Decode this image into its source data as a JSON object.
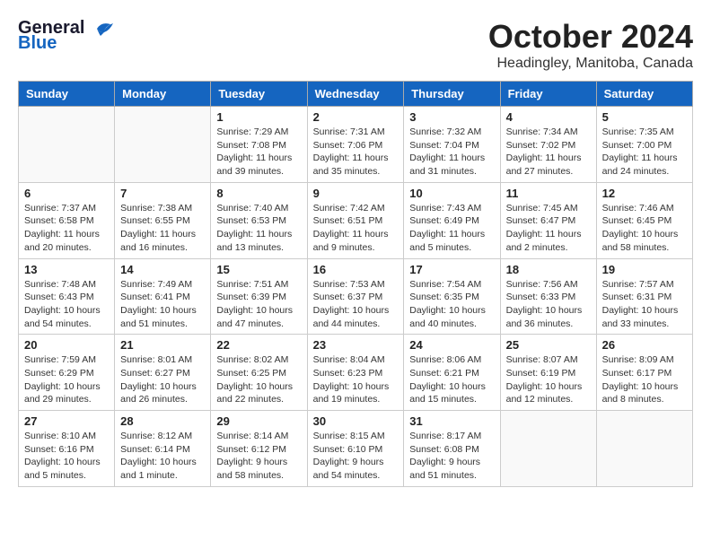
{
  "header": {
    "logo_general": "General",
    "logo_blue": "Blue",
    "month": "October 2024",
    "location": "Headingley, Manitoba, Canada"
  },
  "weekdays": [
    "Sunday",
    "Monday",
    "Tuesday",
    "Wednesday",
    "Thursday",
    "Friday",
    "Saturday"
  ],
  "weeks": [
    [
      {
        "day": "",
        "info": ""
      },
      {
        "day": "",
        "info": ""
      },
      {
        "day": "1",
        "info": "Sunrise: 7:29 AM\nSunset: 7:08 PM\nDaylight: 11 hours and 39 minutes."
      },
      {
        "day": "2",
        "info": "Sunrise: 7:31 AM\nSunset: 7:06 PM\nDaylight: 11 hours and 35 minutes."
      },
      {
        "day": "3",
        "info": "Sunrise: 7:32 AM\nSunset: 7:04 PM\nDaylight: 11 hours and 31 minutes."
      },
      {
        "day": "4",
        "info": "Sunrise: 7:34 AM\nSunset: 7:02 PM\nDaylight: 11 hours and 27 minutes."
      },
      {
        "day": "5",
        "info": "Sunrise: 7:35 AM\nSunset: 7:00 PM\nDaylight: 11 hours and 24 minutes."
      }
    ],
    [
      {
        "day": "6",
        "info": "Sunrise: 7:37 AM\nSunset: 6:58 PM\nDaylight: 11 hours and 20 minutes."
      },
      {
        "day": "7",
        "info": "Sunrise: 7:38 AM\nSunset: 6:55 PM\nDaylight: 11 hours and 16 minutes."
      },
      {
        "day": "8",
        "info": "Sunrise: 7:40 AM\nSunset: 6:53 PM\nDaylight: 11 hours and 13 minutes."
      },
      {
        "day": "9",
        "info": "Sunrise: 7:42 AM\nSunset: 6:51 PM\nDaylight: 11 hours and 9 minutes."
      },
      {
        "day": "10",
        "info": "Sunrise: 7:43 AM\nSunset: 6:49 PM\nDaylight: 11 hours and 5 minutes."
      },
      {
        "day": "11",
        "info": "Sunrise: 7:45 AM\nSunset: 6:47 PM\nDaylight: 11 hours and 2 minutes."
      },
      {
        "day": "12",
        "info": "Sunrise: 7:46 AM\nSunset: 6:45 PM\nDaylight: 10 hours and 58 minutes."
      }
    ],
    [
      {
        "day": "13",
        "info": "Sunrise: 7:48 AM\nSunset: 6:43 PM\nDaylight: 10 hours and 54 minutes."
      },
      {
        "day": "14",
        "info": "Sunrise: 7:49 AM\nSunset: 6:41 PM\nDaylight: 10 hours and 51 minutes."
      },
      {
        "day": "15",
        "info": "Sunrise: 7:51 AM\nSunset: 6:39 PM\nDaylight: 10 hours and 47 minutes."
      },
      {
        "day": "16",
        "info": "Sunrise: 7:53 AM\nSunset: 6:37 PM\nDaylight: 10 hours and 44 minutes."
      },
      {
        "day": "17",
        "info": "Sunrise: 7:54 AM\nSunset: 6:35 PM\nDaylight: 10 hours and 40 minutes."
      },
      {
        "day": "18",
        "info": "Sunrise: 7:56 AM\nSunset: 6:33 PM\nDaylight: 10 hours and 36 minutes."
      },
      {
        "day": "19",
        "info": "Sunrise: 7:57 AM\nSunset: 6:31 PM\nDaylight: 10 hours and 33 minutes."
      }
    ],
    [
      {
        "day": "20",
        "info": "Sunrise: 7:59 AM\nSunset: 6:29 PM\nDaylight: 10 hours and 29 minutes."
      },
      {
        "day": "21",
        "info": "Sunrise: 8:01 AM\nSunset: 6:27 PM\nDaylight: 10 hours and 26 minutes."
      },
      {
        "day": "22",
        "info": "Sunrise: 8:02 AM\nSunset: 6:25 PM\nDaylight: 10 hours and 22 minutes."
      },
      {
        "day": "23",
        "info": "Sunrise: 8:04 AM\nSunset: 6:23 PM\nDaylight: 10 hours and 19 minutes."
      },
      {
        "day": "24",
        "info": "Sunrise: 8:06 AM\nSunset: 6:21 PM\nDaylight: 10 hours and 15 minutes."
      },
      {
        "day": "25",
        "info": "Sunrise: 8:07 AM\nSunset: 6:19 PM\nDaylight: 10 hours and 12 minutes."
      },
      {
        "day": "26",
        "info": "Sunrise: 8:09 AM\nSunset: 6:17 PM\nDaylight: 10 hours and 8 minutes."
      }
    ],
    [
      {
        "day": "27",
        "info": "Sunrise: 8:10 AM\nSunset: 6:16 PM\nDaylight: 10 hours and 5 minutes."
      },
      {
        "day": "28",
        "info": "Sunrise: 8:12 AM\nSunset: 6:14 PM\nDaylight: 10 hours and 1 minute."
      },
      {
        "day": "29",
        "info": "Sunrise: 8:14 AM\nSunset: 6:12 PM\nDaylight: 9 hours and 58 minutes."
      },
      {
        "day": "30",
        "info": "Sunrise: 8:15 AM\nSunset: 6:10 PM\nDaylight: 9 hours and 54 minutes."
      },
      {
        "day": "31",
        "info": "Sunrise: 8:17 AM\nSunset: 6:08 PM\nDaylight: 9 hours and 51 minutes."
      },
      {
        "day": "",
        "info": ""
      },
      {
        "day": "",
        "info": ""
      }
    ]
  ]
}
